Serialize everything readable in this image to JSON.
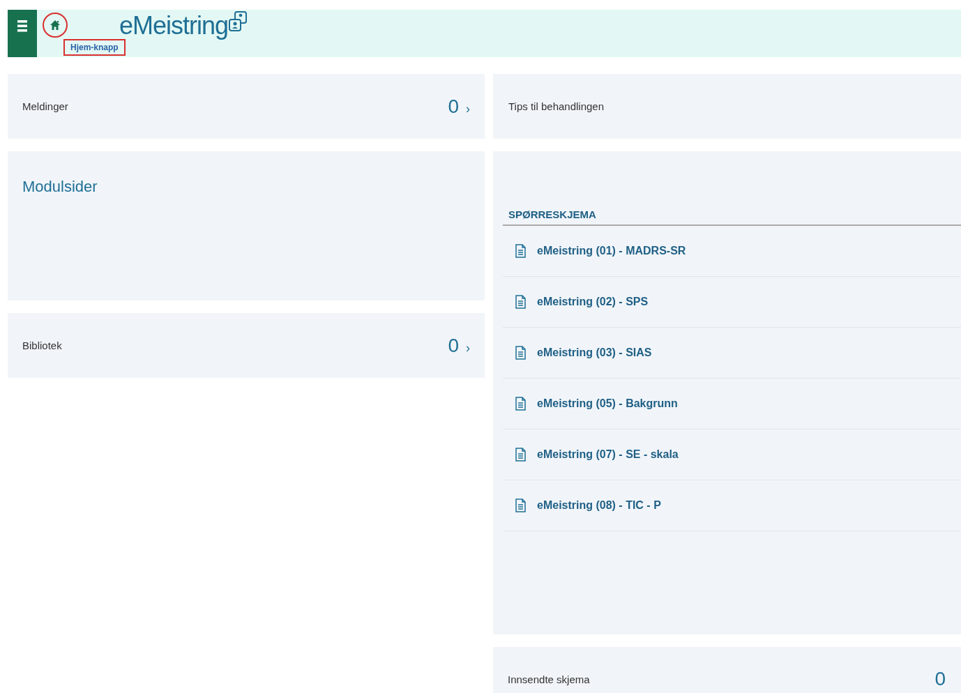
{
  "header": {
    "logo": "eMeistring",
    "home_annotation": "Hjem-knapp"
  },
  "left_cards": [
    {
      "kind": "counter",
      "title": "Meldinger",
      "count": "0",
      "chevron": "›"
    },
    {
      "kind": "heading",
      "title": "Modulsider"
    },
    {
      "kind": "counter",
      "title": "Bibliotek",
      "count": "0",
      "chevron": "›"
    }
  ],
  "tips": {
    "title": "Tips til behandlingen"
  },
  "questionnaires": {
    "heading": "SPØRRESKJEMA",
    "items": [
      "eMeistring (01) - MADRS-SR",
      "eMeistring (02) - SPS",
      "eMeistring (03) - SIAS",
      "eMeistring (05) - Bakgrunn",
      "eMeistring (07) - SE - skala",
      "eMeistring (08) - TIC - P"
    ]
  },
  "submitted": {
    "title": "Innsendte skjema",
    "count": "0"
  }
}
